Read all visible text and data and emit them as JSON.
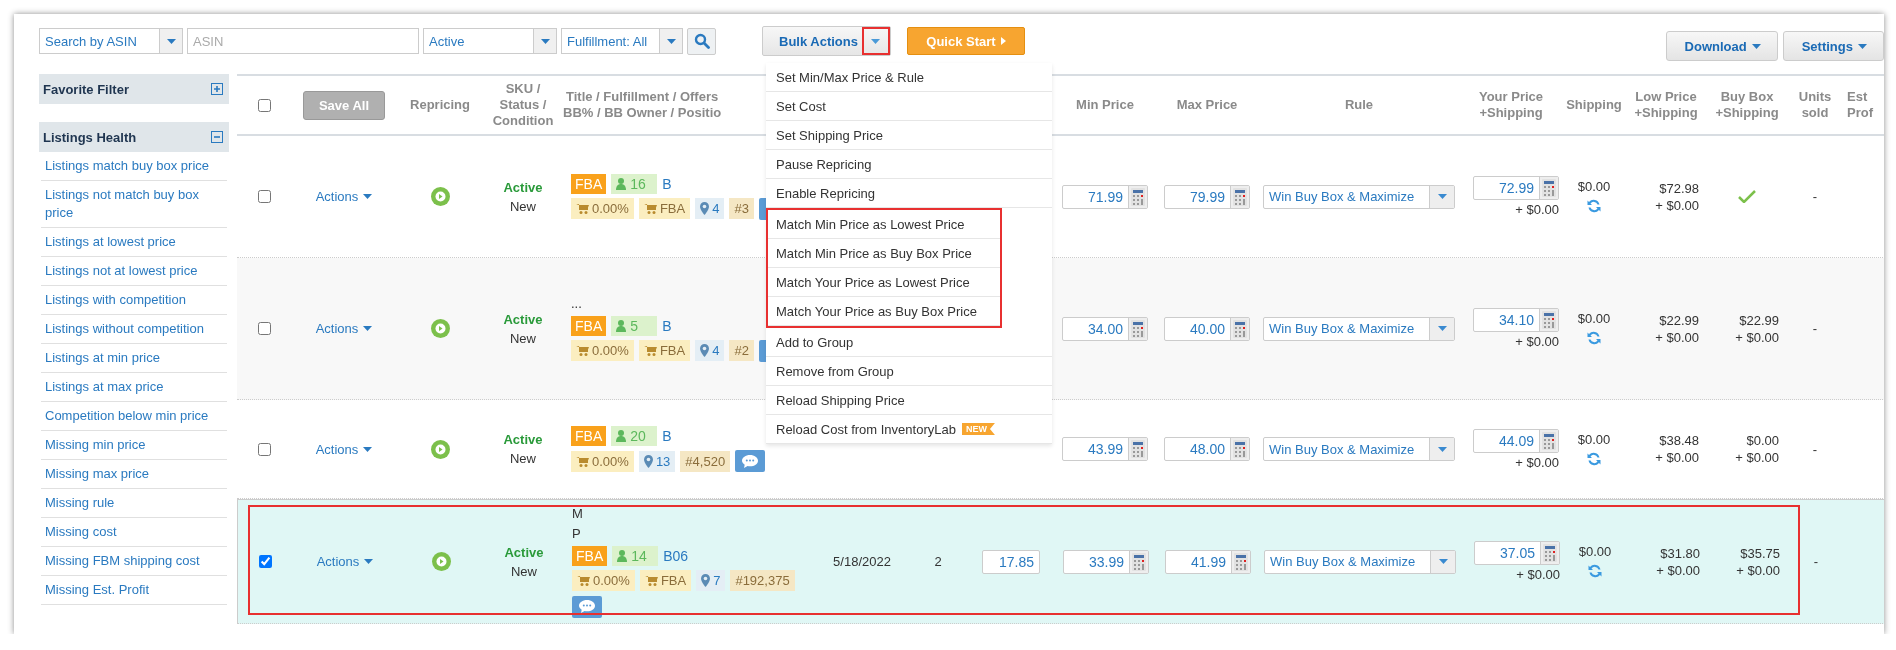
{
  "toolbar": {
    "search_by": "Search by ASIN",
    "asin": {
      "placeholder": "ASIN"
    },
    "status": "Active",
    "fulfillment": "Fulfillment: All",
    "bulk_actions": {
      "label": "Bulk Actions",
      "expanded": true,
      "caret_annotated": true
    },
    "quick_start": "Quick Start",
    "download": "Download",
    "settings": "Settings"
  },
  "bulk_menu": [
    {
      "label": "Set Min/Max Price & Rule",
      "annotated": false
    },
    {
      "label": "Set Cost",
      "annotated": false
    },
    {
      "label": "Set Shipping Price",
      "annotated": false
    },
    {
      "label": "Pause Repricing",
      "annotated": false
    },
    {
      "label": "Enable Repricing",
      "annotated": false
    },
    {
      "label": "Match Min Price as Lowest Price",
      "annotated": true
    },
    {
      "label": "Match Min Price as Buy Box Price",
      "annotated": true
    },
    {
      "label": "Match Your Price as Lowest Price",
      "annotated": true
    },
    {
      "label": "Match Your Price as Buy Box Price",
      "annotated": true
    },
    {
      "label": "Add to Group",
      "annotated": false
    },
    {
      "label": "Remove from Group",
      "annotated": false
    },
    {
      "label": "Reload Shipping Price",
      "annotated": false
    },
    {
      "label": "Reload Cost from InventoryLab",
      "annotated": false,
      "badge": "NEW"
    }
  ],
  "sidebar": {
    "sections": [
      {
        "title": "Favorite Filter",
        "expanded": false
      },
      {
        "title": "Listings Health",
        "expanded": true,
        "items": [
          "Listings match buy box price",
          "Listings not match buy box price",
          "Listings at lowest price",
          "Listings not at lowest price",
          "Listings with competition",
          "Listings without competition",
          "Listings at min price",
          "Listings at max price",
          "Competition below min price",
          "Missing min price",
          "Missing max price",
          "Missing rule",
          "Missing cost",
          "Missing FBM shipping cost",
          "Missing Est. Profit"
        ]
      }
    ]
  },
  "table": {
    "select_all": {
      "checked": false
    },
    "save_all": {
      "label": "Save All",
      "disabled": true
    },
    "columns": [
      {
        "lines": [
          "Repricing"
        ]
      },
      {
        "lines": [
          "SKU /",
          "Status /",
          "Condition"
        ]
      },
      {
        "lines": [
          "Title / Fulfillment / Offers",
          "BB% / BB Owner / Positio"
        ]
      },
      {
        "lines": [
          "Min Price"
        ]
      },
      {
        "lines": [
          "Max Price"
        ]
      },
      {
        "lines": [
          "Rule"
        ]
      },
      {
        "lines": [
          "Your Price",
          "+Shipping"
        ]
      },
      {
        "lines": [
          "Shipping"
        ]
      },
      {
        "lines": [
          "Low Price",
          "+Shipping"
        ]
      },
      {
        "lines": [
          "Buy Box",
          "+Shipping"
        ]
      },
      {
        "lines": [
          "Units",
          "sold"
        ]
      },
      {
        "lines": [
          "Est",
          "Prof"
        ]
      }
    ],
    "rows": [
      {
        "selected": false,
        "annotated": false,
        "actions": "Actions",
        "status": "Active",
        "condition": "New",
        "title_lines": [],
        "fulfillment": "FBA",
        "offers": "16",
        "asin": "B",
        "badges": [
          {
            "kind": "cart",
            "text": "0.00%"
          },
          {
            "kind": "cart",
            "text": "FBA"
          },
          {
            "kind": "pin",
            "text": "4"
          },
          {
            "kind": "rank",
            "text": "#3"
          }
        ],
        "min_price": "71.99",
        "max_price": "79.99",
        "rule": "Win Buy Box & Maximize",
        "your_price": "72.99",
        "your_shipping": "+ $0.00",
        "shipping": "$0.00",
        "low_price": "$72.98",
        "low_shipping": "+ $0.00",
        "buy_box": {
          "kind": "check"
        },
        "units_sold": "-"
      },
      {
        "selected": false,
        "annotated": false,
        "actions": "Actions",
        "status": "Active",
        "condition": "New",
        "title_lines": [
          "..."
        ],
        "fulfillment": "FBA",
        "offers": "5",
        "asin": "B",
        "badges": [
          {
            "kind": "cart",
            "text": "0.00%"
          },
          {
            "kind": "cart",
            "text": "FBA"
          },
          {
            "kind": "pin",
            "text": "4"
          },
          {
            "kind": "rank",
            "text": "#2"
          }
        ],
        "min_price": "34.00",
        "max_price": "40.00",
        "rule": "Win Buy Box & Maximize",
        "your_price": "34.10",
        "your_shipping": "+ $0.00",
        "shipping": "$0.00",
        "low_price": "$22.99",
        "low_shipping": "+ $0.00",
        "buy_box": {
          "kind": "price",
          "price": "$22.99",
          "shipping": "+ $0.00"
        },
        "units_sold": "-"
      },
      {
        "selected": false,
        "annotated": false,
        "actions": "Actions",
        "status": "Active",
        "condition": "New",
        "title_lines": [],
        "fulfillment": "FBA",
        "offers": "20",
        "asin": "B",
        "badges": [
          {
            "kind": "cart",
            "text": "0.00%"
          },
          {
            "kind": "pin",
            "text": "13"
          },
          {
            "kind": "rank",
            "text": "#4,520"
          }
        ],
        "min_price": "43.99",
        "max_price": "48.00",
        "rule": "Win Buy Box & Maximize",
        "your_price": "44.09",
        "your_shipping": "+ $0.00",
        "shipping": "$0.00",
        "low_price": "$38.48",
        "low_shipping": "+ $0.00",
        "buy_box": {
          "kind": "price",
          "price": "$0.00",
          "shipping": "+ $0.00"
        },
        "units_sold": "-"
      },
      {
        "selected": true,
        "annotated": true,
        "actions": "Actions",
        "status": "Active",
        "condition": "New",
        "title_lines": [
          "M",
          "P"
        ],
        "fulfillment": "FBA",
        "offers": "14",
        "asin": "B06",
        "badges": [
          {
            "kind": "cart",
            "text": "0.00%"
          },
          {
            "kind": "cart",
            "text": "FBA"
          },
          {
            "kind": "pin",
            "text": "7"
          },
          {
            "kind": "rank",
            "text": "#192,375"
          }
        ],
        "date": "5/18/2022",
        "quantity": "2",
        "cost": "17.85",
        "min_price": "33.99",
        "max_price": "41.99",
        "rule": "Win Buy Box & Maximize",
        "your_price": "37.05",
        "your_shipping": "+ $0.00",
        "shipping": "$0.00",
        "low_price": "$31.80",
        "low_shipping": "+ $0.00",
        "buy_box": {
          "kind": "price",
          "price": "$35.75",
          "shipping": "+ $0.00"
        },
        "units_sold": "-"
      }
    ]
  }
}
